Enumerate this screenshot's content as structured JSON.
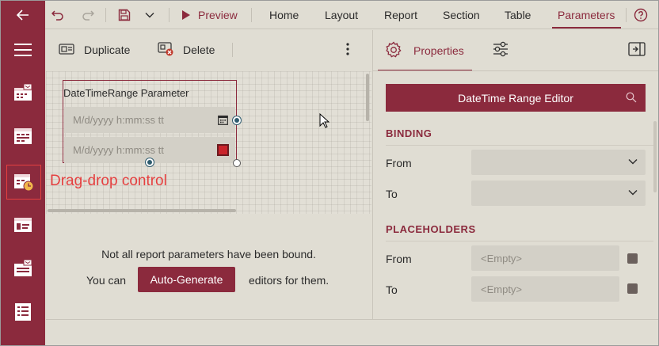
{
  "nav": {
    "back_icon": "arrow-left-icon",
    "menu_icon": "hamburger-icon",
    "items": [
      {
        "icon": "calendar-dropdown-icon"
      },
      {
        "icon": "calendar-range-icon"
      },
      {
        "icon": "datetime-range-icon"
      },
      {
        "icon": "card-id-icon"
      },
      {
        "icon": "list-dropdown-icon"
      },
      {
        "icon": "list-icon"
      }
    ]
  },
  "toolbar": {
    "preview_label": "Preview",
    "tabs": [
      "Home",
      "Layout",
      "Report",
      "Section",
      "Table",
      "Parameters"
    ],
    "active_tab": "Parameters"
  },
  "toolbar2": {
    "duplicate_label": "Duplicate",
    "delete_label": "Delete"
  },
  "designer": {
    "control_title": "DateTimeRange Parameter",
    "from_placeholder": "M/d/yyyy h:mm:ss tt",
    "to_placeholder": "M/d/yyyy h:mm:ss tt",
    "annotation": "Drag-drop control",
    "message": "Not all report parameters have been bound.",
    "you_can": "You can",
    "auto_generate_label": "Auto-Generate",
    "editors_for_them": "editors for them."
  },
  "properties": {
    "tab_label": "Properties",
    "editor_button_label": "DateTime Range Editor",
    "binding": {
      "heading": "BINDING",
      "from_label": "From",
      "from_value": "",
      "to_label": "To",
      "to_value": ""
    },
    "placeholders": {
      "heading": "PLACEHOLDERS",
      "from_label": "From",
      "from_value": "<Empty>",
      "to_label": "To",
      "to_value": "<Empty>"
    }
  },
  "colors": {
    "accent": "#8b2a3d",
    "background": "#e0ddd3",
    "annotation": "#e54040",
    "input": "#d3d0c7"
  }
}
